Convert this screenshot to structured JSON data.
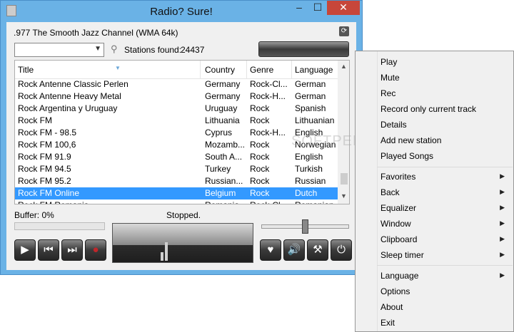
{
  "window": {
    "title": "Radio? Sure!",
    "min_glyph": "–",
    "max_glyph": "☐",
    "close_glyph": "✕",
    "app_icon": "radio-app-icon"
  },
  "current_station": ".977 The Smooth Jazz Channel (WMA 64k)",
  "search": {
    "value": "",
    "found_label": "Stations found:",
    "found_count": "24437"
  },
  "table": {
    "columns": [
      "Title",
      "Country",
      "Genre",
      "Language"
    ],
    "rows": [
      [
        "Rock Antenne Classic Perlen",
        "Germany",
        "Rock-Cl...",
        "German"
      ],
      [
        "Rock Antenne Heavy Metal",
        "Germany",
        "Rock-H...",
        "German"
      ],
      [
        "Rock Argentina y Uruguay",
        "Uruguay",
        "Rock",
        "Spanish"
      ],
      [
        "Rock FM",
        "Lithuania",
        "Rock",
        "Lithuanian"
      ],
      [
        "Rock FM - 98.5",
        "Cyprus",
        "Rock-H...",
        "English"
      ],
      [
        "Rock FM 100,6",
        "Mozamb...",
        "Rock",
        "Norwegian"
      ],
      [
        "Rock FM 91.9",
        "South A...",
        "Rock",
        "English"
      ],
      [
        "Rock FM 94.5",
        "Turkey",
        "Rock",
        "Turkish"
      ],
      [
        "Rock FM 95.2",
        "Russian...",
        "Rock",
        "Russian"
      ],
      [
        "Rock FM Online",
        "Belgium",
        "Rock",
        "Dutch"
      ],
      [
        "Rock FM Romania",
        "Romania",
        "Rock-Cl...",
        "Romanian"
      ]
    ],
    "selected_index": 9
  },
  "player": {
    "buffer": "Buffer: 0%",
    "status": "Stopped.",
    "volume": 0.5
  },
  "controls": {
    "play": "▶",
    "prev": "⏮",
    "next": "⏭",
    "record": "●",
    "favorite": "♥",
    "volume": "🔊",
    "settings": "⚒",
    "power": "⏻"
  },
  "context_menu": {
    "group1": [
      "Play",
      "Mute",
      "Rec",
      "Record only current track",
      "Details",
      "Add new station",
      "Played Songs"
    ],
    "group2": [
      "Favorites",
      "Back",
      "Equalizer",
      "Window",
      "Clipboard",
      "Sleep timer"
    ],
    "group3": [
      "Language",
      "Options",
      "About",
      "Exit"
    ],
    "submenu_arrow": "▶"
  },
  "watermark": "SOFTPEDIA"
}
